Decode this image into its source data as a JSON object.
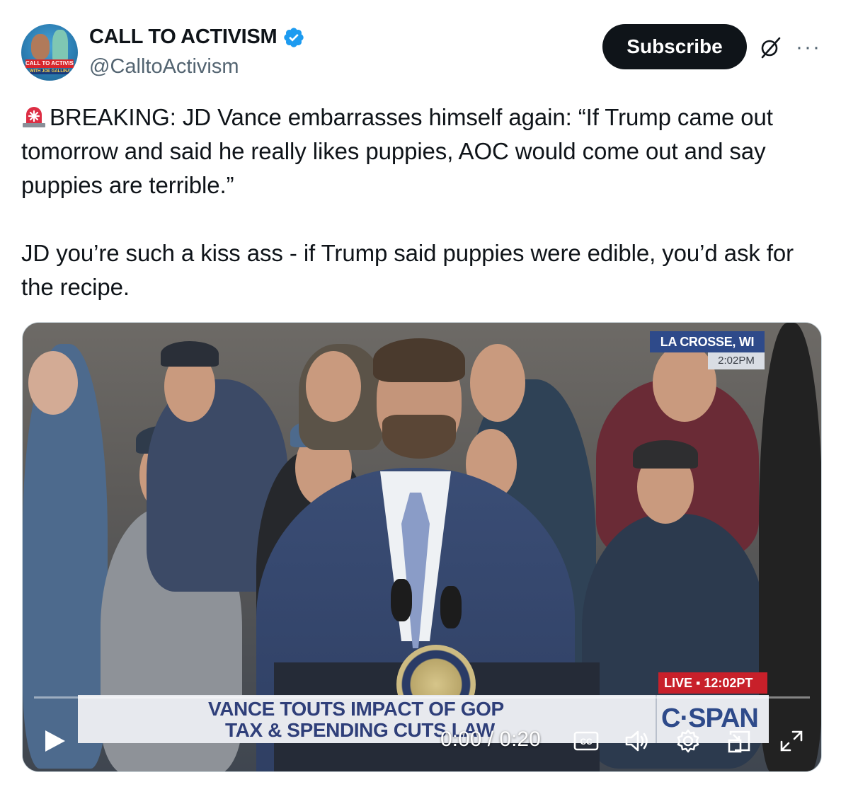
{
  "author": {
    "display_name": "CALL TO ACTIVISM",
    "handle": "@CalltoActivism",
    "avatar_banner_text": "CALL TO ACTIVISM",
    "avatar_sub_text": "WITH JOE GALLINA",
    "verified": true
  },
  "actions": {
    "subscribe_label": "Subscribe",
    "more_label": "···"
  },
  "tweet": {
    "text": "BREAKING: JD Vance embarrasses himself again: “If Trump came out tomorrow and said he really likes puppies, AOC would come out and say puppies are terrible.”\n\nJD you’re such a kiss ass - if Trump said puppies were edible, you’d ask for the recipe."
  },
  "video": {
    "location": "LA CROSSE, WI",
    "clock": "2:02PM",
    "live_label": "LIVE ▪ 12:02PT",
    "chyron_line1": "VANCE TOUTS IMPACT OF GOP",
    "chyron_line2": "TAX & SPENDING CUTS LAW",
    "network": "C·SPAN",
    "current_time": "0:00",
    "duration": "0:20",
    "time_display": "0:00 / 0:20",
    "progress": 0.0
  },
  "colors": {
    "brand_dark": "#0f1419",
    "muted": "#536471",
    "verified_blue": "#1d9bf0",
    "cspan_blue": "#2e4a8a",
    "live_red": "#c8202a"
  },
  "icons": {
    "siren": "rotating-light-emoji",
    "verified": "verified-badge-icon",
    "grok": "grok-icon",
    "play": "play-icon",
    "captions": "closed-captions-icon",
    "volume": "volume-icon",
    "settings": "gear-icon",
    "pip": "picture-in-picture-icon",
    "fullscreen": "fullscreen-icon"
  }
}
